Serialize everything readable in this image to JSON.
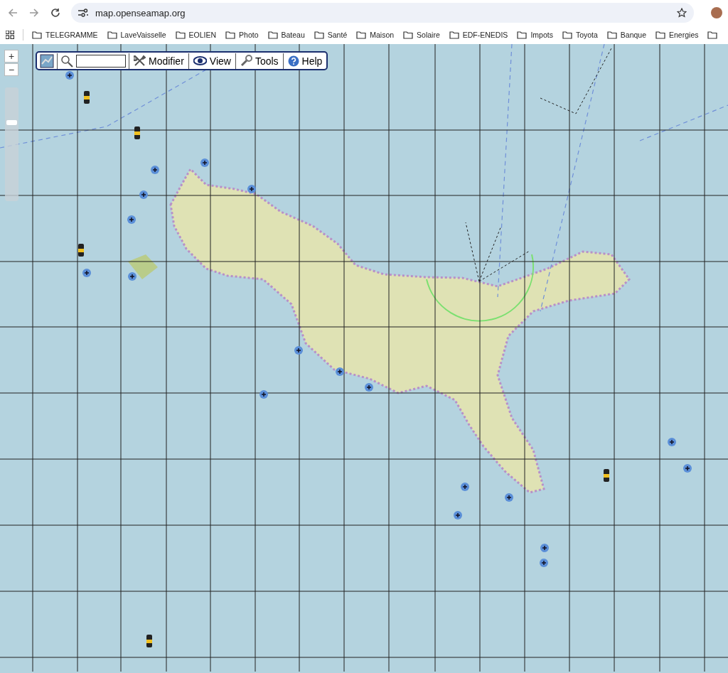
{
  "browser": {
    "url": "map.openseamap.org"
  },
  "bookmarks": [
    {
      "label": "TELEGRAMME"
    },
    {
      "label": "LaveVaisselle"
    },
    {
      "label": "EOLIEN"
    },
    {
      "label": "Photo"
    },
    {
      "label": "Bateau"
    },
    {
      "label": "Santé"
    },
    {
      "label": "Maison"
    },
    {
      "label": "Solaire"
    },
    {
      "label": "EDF-ENEDIS"
    },
    {
      "label": "Impots"
    },
    {
      "label": "Toyota"
    },
    {
      "label": "Banque"
    },
    {
      "label": "Energies"
    }
  ],
  "map": {
    "zoom_in": "+",
    "zoom_out": "−",
    "zoom_slider": {
      "level": 0.7
    },
    "toolbar": {
      "buttons": [
        {
          "label": "Modifier",
          "kind": "tools"
        },
        {
          "label": "View",
          "kind": "eye"
        },
        {
          "label": "Tools",
          "kind": "wrench"
        },
        {
          "label": "Help",
          "kind": "help"
        }
      ]
    }
  }
}
